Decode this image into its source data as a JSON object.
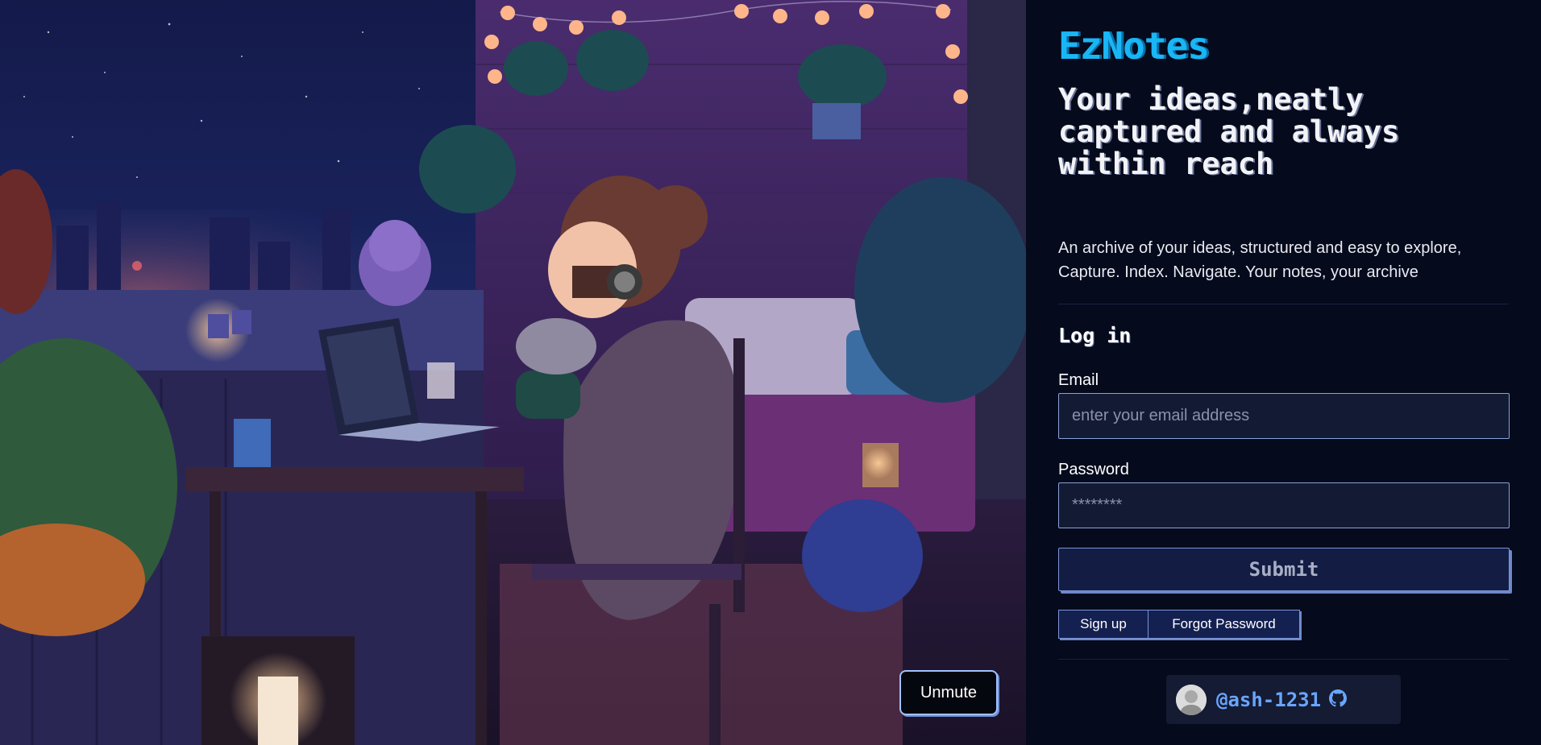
{
  "scene": {
    "unmute_label": "Unmute"
  },
  "brand": {
    "logo": "EzNotes"
  },
  "hero": {
    "headline": "Your ideas,neatly captured and always within reach",
    "tagline_line1": "An archive of your ideas, structured and easy to explore,",
    "tagline_line2": "Capture. Index. Navigate. Your notes, your archive"
  },
  "login": {
    "title": "Log in",
    "email_label": "Email",
    "email_placeholder": "enter your email address",
    "password_label": "Password",
    "password_placeholder": "********",
    "submit_label": "Submit",
    "signup_label": "Sign up",
    "forgot_label": "Forgot Password"
  },
  "footer": {
    "github_handle": "@ash-1231",
    "github_icon": "github-icon"
  },
  "colors": {
    "panel_bg": "#050a1c",
    "brand": "#19b6f5",
    "accent_border": "#8aa2d8",
    "handle": "#69a5ff"
  }
}
